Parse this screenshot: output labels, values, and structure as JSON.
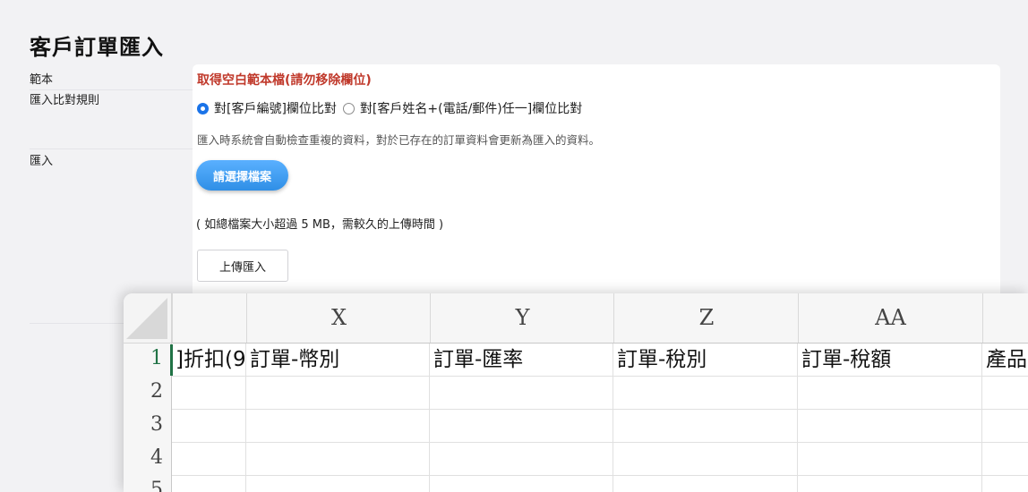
{
  "page": {
    "title": "客戶訂單匯入"
  },
  "labels": {
    "template": "範本",
    "rule": "匯入比對規則",
    "import": "匯入"
  },
  "template": {
    "link": "取得空白範本檔(請勿移除欄位)"
  },
  "rule": {
    "options": [
      {
        "label": "對[客戶編號]欄位比對",
        "checked": true
      },
      {
        "label": "對[客戶姓名+(電話/郵件)任一]欄位比對",
        "checked": false
      }
    ],
    "note": "匯入時系統會自動檢查重複的資料，對於已存在的訂單資料會更新為匯入的資料。"
  },
  "import": {
    "choose_button": "請選擇檔案",
    "size_note": "( 如總檔案大小超過 5 MB，需較久的上傳時間 )",
    "upload_button": "上傳匯入"
  },
  "spreadsheet": {
    "columns": [
      "",
      "X",
      "Y",
      "Z",
      "AA",
      ""
    ],
    "rows": [
      "1",
      "2",
      "3",
      "4",
      "5"
    ],
    "row1": [
      "]折扣(9",
      "訂單-幣別",
      "訂單-匯率",
      "訂單-稅別",
      "訂單-稅額",
      "產品"
    ],
    "colors": {
      "active_row_header": "#217346"
    }
  }
}
